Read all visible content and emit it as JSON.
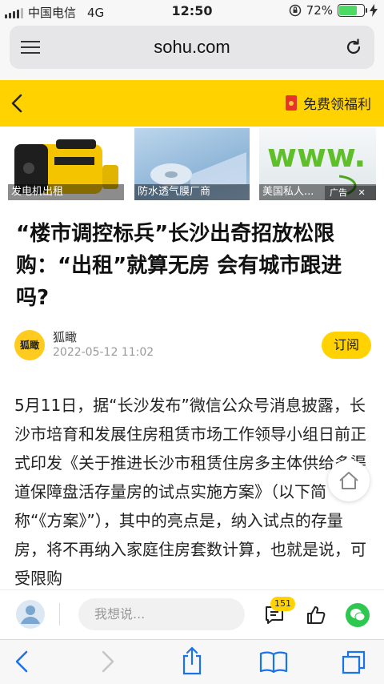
{
  "status_bar": {
    "carrier": "中国电信",
    "network": "4G",
    "time": "12:50",
    "battery_percent": "72%",
    "battery_level": 0.72
  },
  "browser": {
    "domain": "sohu.com"
  },
  "header": {
    "promo_label": "免费领福利",
    "accent_color": "#ffd200"
  },
  "ads": [
    {
      "caption": "发电机出租"
    },
    {
      "caption": "防水透气膜厂商"
    },
    {
      "caption": "美国私人..."
    }
  ],
  "ad_tag": "广告",
  "article": {
    "title": "“楼市调控标兵”长沙出奇招放松限购：“出租”就算无房 会有城市跟进吗?",
    "author_name": "狐瞰",
    "author_avatar_text": "狐瞰",
    "date": "2022-05-12 11:02",
    "subscribe_label": "订阅",
    "body": "5月11日，据“长沙发布”微信公众号消息披露，长沙市培育和发展住房租赁市场工作领导小组日前正式印发《关于推进长沙市租赁住房多主体供给多渠道保障盘活存量房的试点实施方案》（以下简称“《方案》”），其中的亮点是，纳入试点的存量房，将不再纳入家庭住房套数计算，也就是说，可受限购"
  },
  "comment_bar": {
    "placeholder": "我想说...",
    "comment_count": "151"
  }
}
